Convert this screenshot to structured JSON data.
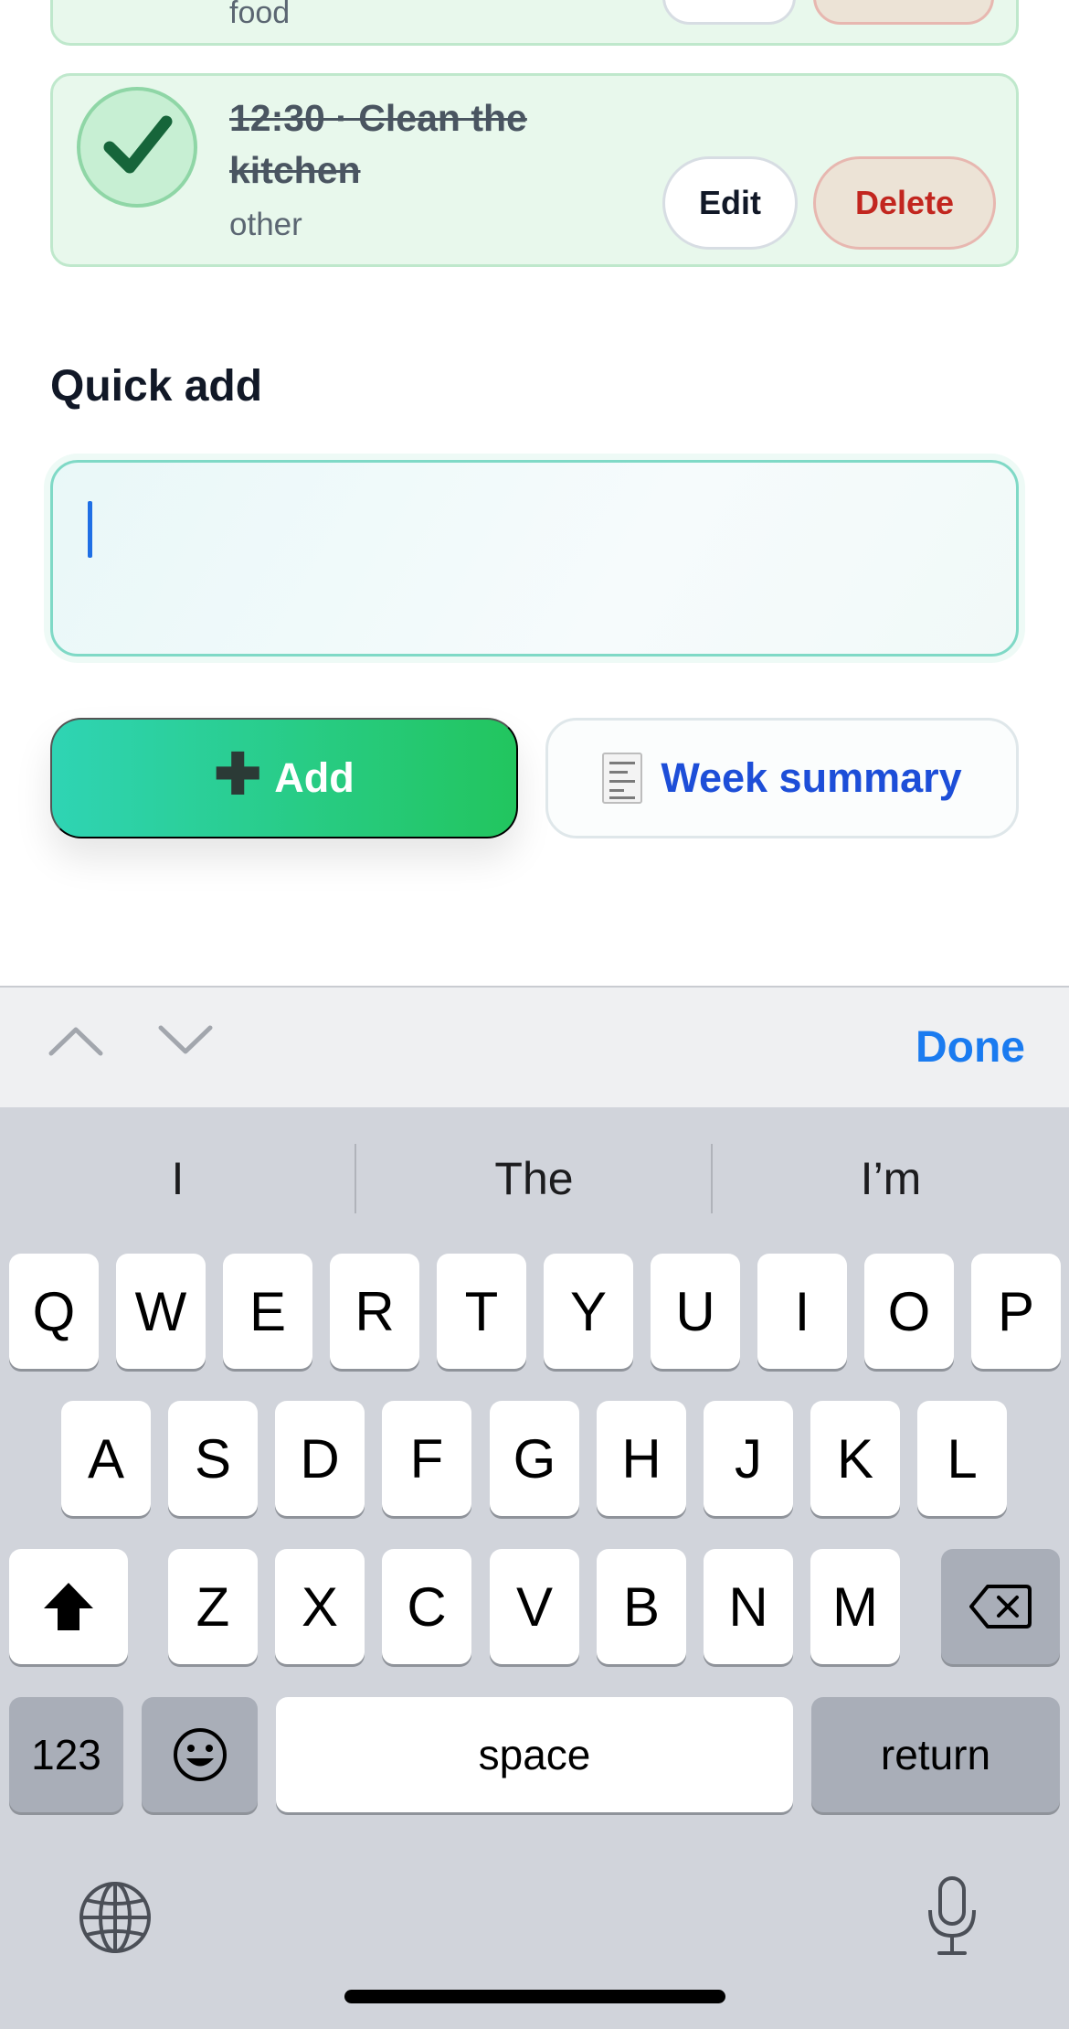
{
  "tasks": [
    {
      "title": "",
      "category": "food",
      "completed": true,
      "edit_label": "",
      "delete_label": ""
    },
    {
      "title": "12:30 · Clean the kitchen",
      "category": "other",
      "completed": true,
      "edit_label": "Edit",
      "delete_label": "Delete"
    }
  ],
  "quick_add": {
    "title": "Quick add",
    "input_value": "",
    "add_label": "Add",
    "add_icon": "plus-icon",
    "week_label": "Week summary",
    "week_icon": "receipt-icon"
  },
  "accessory": {
    "done_label": "Done",
    "prev_icon": "chevron-up-icon",
    "next_icon": "chevron-down-icon"
  },
  "keyboard": {
    "suggestions": [
      "I",
      "The",
      "I’m"
    ],
    "row1": [
      "Q",
      "W",
      "E",
      "R",
      "T",
      "Y",
      "U",
      "I",
      "O",
      "P"
    ],
    "row2": [
      "A",
      "S",
      "D",
      "F",
      "G",
      "H",
      "J",
      "K",
      "L"
    ],
    "row3": [
      "Z",
      "X",
      "C",
      "V",
      "B",
      "N",
      "M"
    ],
    "numbers_label": "123",
    "space_label": "space",
    "return_label": "return",
    "shift_icon": "shift-icon",
    "backspace_icon": "backspace-icon",
    "emoji_icon": "emoji-icon",
    "globe_icon": "globe-icon",
    "mic_icon": "microphone-icon"
  },
  "colors": {
    "accent": "#22c55e",
    "done_blue": "#1a7bf0",
    "delete_red": "#c2261f",
    "week_blue": "#1d4ed8"
  }
}
